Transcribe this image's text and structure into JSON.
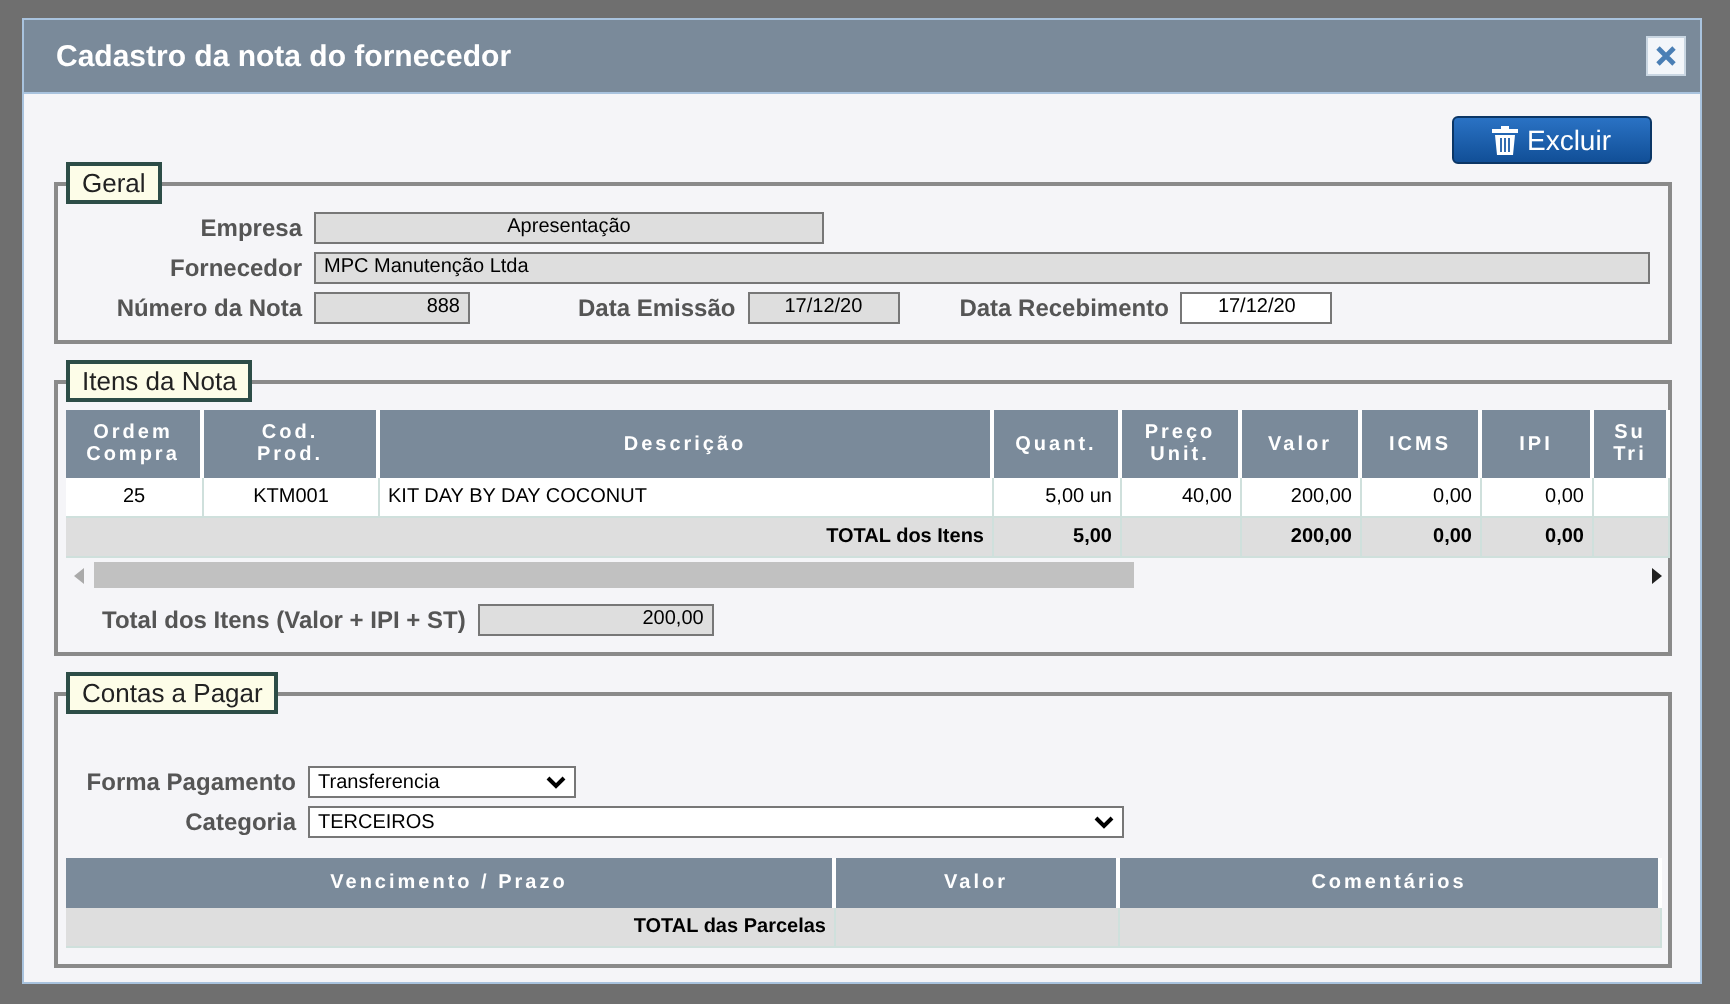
{
  "dialog": {
    "title": "Cadastro da nota do fornecedor"
  },
  "delete_button": {
    "label": "Excluir"
  },
  "geral": {
    "legend": "Geral",
    "empresa": {
      "label": "Empresa",
      "value": "Apresentação",
      "readonly": true
    },
    "fornecedor": {
      "label": "Fornecedor",
      "value": "MPC Manutenção Ltda",
      "readonly": true
    },
    "numero": {
      "label": "Número da Nota",
      "value": "888",
      "readonly": true
    },
    "emissao": {
      "label": "Data Emissão",
      "value": "17/12/20",
      "readonly": true
    },
    "recebimento": {
      "label": "Data Recebimento",
      "value": "17/12/20",
      "readonly": false
    }
  },
  "itens": {
    "legend": "Itens da Nota",
    "columns": [
      "Ordem\nCompra",
      "Cod.\nProd.",
      "Descrição",
      "Quant.",
      "Preço\nUnit.",
      "Valor",
      "ICMS",
      "IPI",
      "Su\nTri"
    ],
    "rows": [
      [
        "25",
        "KTM001",
        "KIT DAY BY DAY COCONUT",
        "5,00 un",
        "40,00",
        "200,00",
        "0,00",
        "0,00",
        null
      ]
    ],
    "total_row": {
      "label": "TOTAL dos Itens",
      "values": {
        "quant": "5,00",
        "valor": "200,00",
        "icms": "0,00",
        "ipi": "0,00"
      }
    },
    "total": {
      "label": "Total dos Itens (Valor + IPI + ST)",
      "value": "200,00"
    }
  },
  "contas": {
    "legend": "Contas a Pagar",
    "forma_pagamento": {
      "label": "Forma Pagamento",
      "value": "Transferencia"
    },
    "categoria": {
      "label": "Categoria",
      "value": "TERCEIROS"
    },
    "columns": [
      "Vencimento / Prazo",
      "Valor",
      "Comentários"
    ],
    "total_row": {
      "label": "TOTAL das Parcelas"
    }
  }
}
